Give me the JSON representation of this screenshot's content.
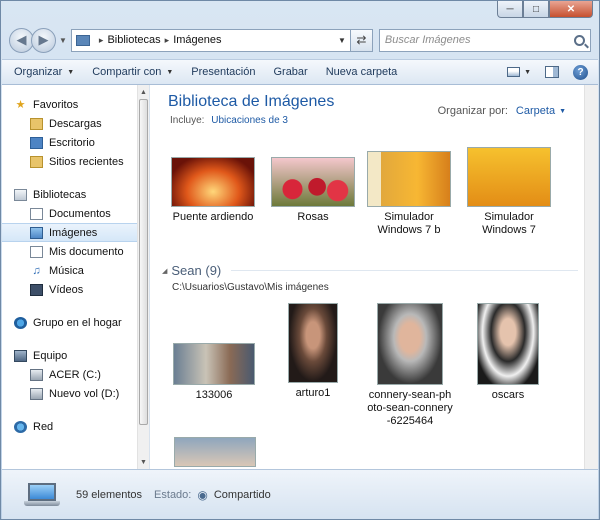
{
  "window": {
    "minimize_glyph": "─",
    "maximize_glyph": "□",
    "close_glyph": "✕"
  },
  "address": {
    "crumbs": [
      "Bibliotecas",
      "Imágenes"
    ],
    "separator": "▸",
    "search_placeholder": "Buscar Imágenes"
  },
  "toolbar": {
    "organize": "Organizar",
    "share": "Compartir con",
    "slideshow": "Presentación",
    "burn": "Grabar",
    "new_folder": "Nueva carpeta",
    "help": "?"
  },
  "sidebar": {
    "favorites": {
      "label": "Favoritos",
      "items": [
        "Descargas",
        "Escritorio",
        "Sitios recientes"
      ]
    },
    "libraries": {
      "label": "Bibliotecas",
      "items": [
        "Documentos",
        "Imágenes",
        "Mis documento",
        "Música",
        "Vídeos"
      ]
    },
    "homegroup": "Grupo en el hogar",
    "computer": {
      "label": "Equipo",
      "items": [
        "ACER (C:)",
        "Nuevo vol (D:)"
      ]
    },
    "network": "Red"
  },
  "library": {
    "title": "Biblioteca de Imágenes",
    "includes_label": "Incluye:",
    "includes_link": "Ubicaciones de 3",
    "arrange_label": "Organizar por:",
    "arrange_value": "Carpeta"
  },
  "items_row1": [
    {
      "label": "Puente ardiendo",
      "label2": ""
    },
    {
      "label": "Rosas",
      "label2": ""
    },
    {
      "label": "Simulador",
      "label2": "Windows 7 b"
    },
    {
      "label": "Simulador",
      "label2": "Windows 7"
    }
  ],
  "group": {
    "title": "Sean (9)",
    "path": "C:\\Usuarios\\Gustavo\\Mis imágenes",
    "items": [
      {
        "label": "133006",
        "label2": "",
        "label3": ""
      },
      {
        "label": "arturo1",
        "label2": "",
        "label3": ""
      },
      {
        "label": "connery-sean-ph",
        "label2": "oto-sean-connery",
        "label3": "-6225464"
      },
      {
        "label": "oscars",
        "label2": "",
        "label3": ""
      }
    ]
  },
  "status": {
    "count": "59 elementos",
    "state_label": "Estado:",
    "state_value": "Compartido"
  },
  "colors": {
    "accent": "#1e5aa5",
    "frame": "#bcd0e6",
    "selection": "#d5e7f8"
  }
}
